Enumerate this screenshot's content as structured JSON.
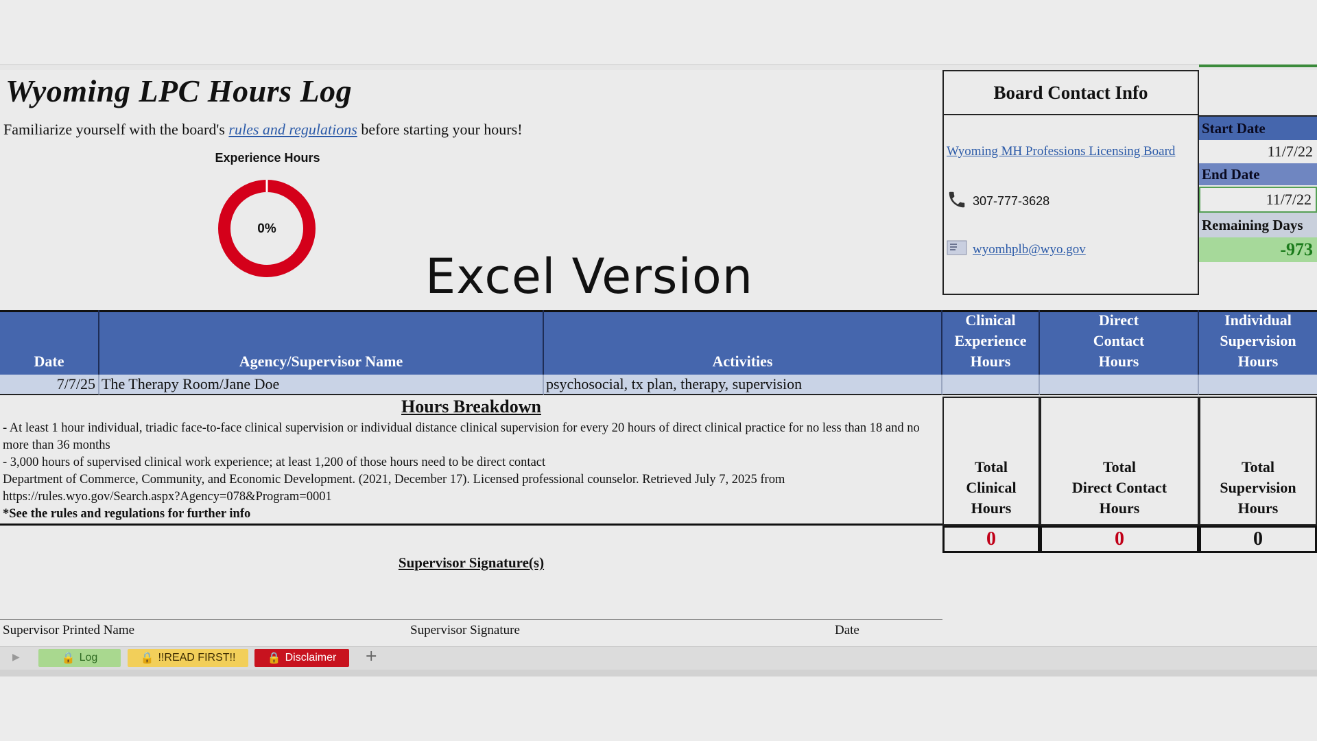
{
  "title": "Wyoming LPC Hours Log",
  "subtitle": {
    "before": "Familiarize yourself with the board's ",
    "link": "rules and regulations",
    "after": " before starting your hours!"
  },
  "ring": {
    "label": "Experience Hours",
    "value": "0%",
    "progress": 0,
    "color": "#d4001a"
  },
  "overlay_text": "Excel Version",
  "board": {
    "title": "Board Contact Info",
    "link": "Wyoming MH Professions Licensing Board",
    "phone": "307-777-3628",
    "email": "wyomhplb@wyo.gov"
  },
  "dates": {
    "start_label": "Start Date",
    "start_value": "11/7/22",
    "end_label": "End Date",
    "end_value": "11/7/22",
    "remaining_label": "Remaining Days",
    "remaining_value": "-973"
  },
  "table": {
    "headers": [
      "Date",
      "Agency/Supervisor Name",
      "Activities",
      "Clinical\nExperience\nHours",
      "Direct\nContact\nHours",
      "Individual\nSupervision\nHours"
    ],
    "rows": [
      [
        "7/7/25",
        "The Therapy Room/Jane Doe",
        "psychosocial, tx plan, therapy, supervision",
        "",
        "",
        ""
      ]
    ]
  },
  "breakdown": {
    "title": "Hours Breakdown",
    "line1": "- At least 1 hour individual, triadic face-to-face clinical supervision or individual distance clinical supervision for every 20 hours of direct clinical practice for no less than 18 and no more than 36 months",
    "line2": "- 3,000 hours of supervised clinical work experience; at least 1,200 of those hours need to be direct contact",
    "line3": "Department of Commerce, Community, and Economic Development. (2021, December 17). Licensed professional counselor. Retrieved July 7, 2025 from https://rules.wyo.gov/Search.aspx?Agency=078&Program=0001",
    "line4": "*See the rules and regulations for further info"
  },
  "totals": {
    "labels": [
      "Total\nClinical\nHours",
      "Total\nDirect Contact\nHours",
      "Total\nSupervision\nHours"
    ],
    "values": [
      "0",
      "0",
      "0"
    ]
  },
  "signature": {
    "title": "Supervisor Signature(s)",
    "printed_name": "Supervisor Printed Name",
    "signature": "Supervisor Signature",
    "date": "Date"
  },
  "tabs": [
    {
      "label": "Log",
      "color": "#a9d88f"
    },
    {
      "label": "!!READ FIRST!!",
      "color": "#f2cf5a"
    },
    {
      "label": "Disclaimer",
      "color": "#c8131f"
    }
  ],
  "add_sheet": "+"
}
